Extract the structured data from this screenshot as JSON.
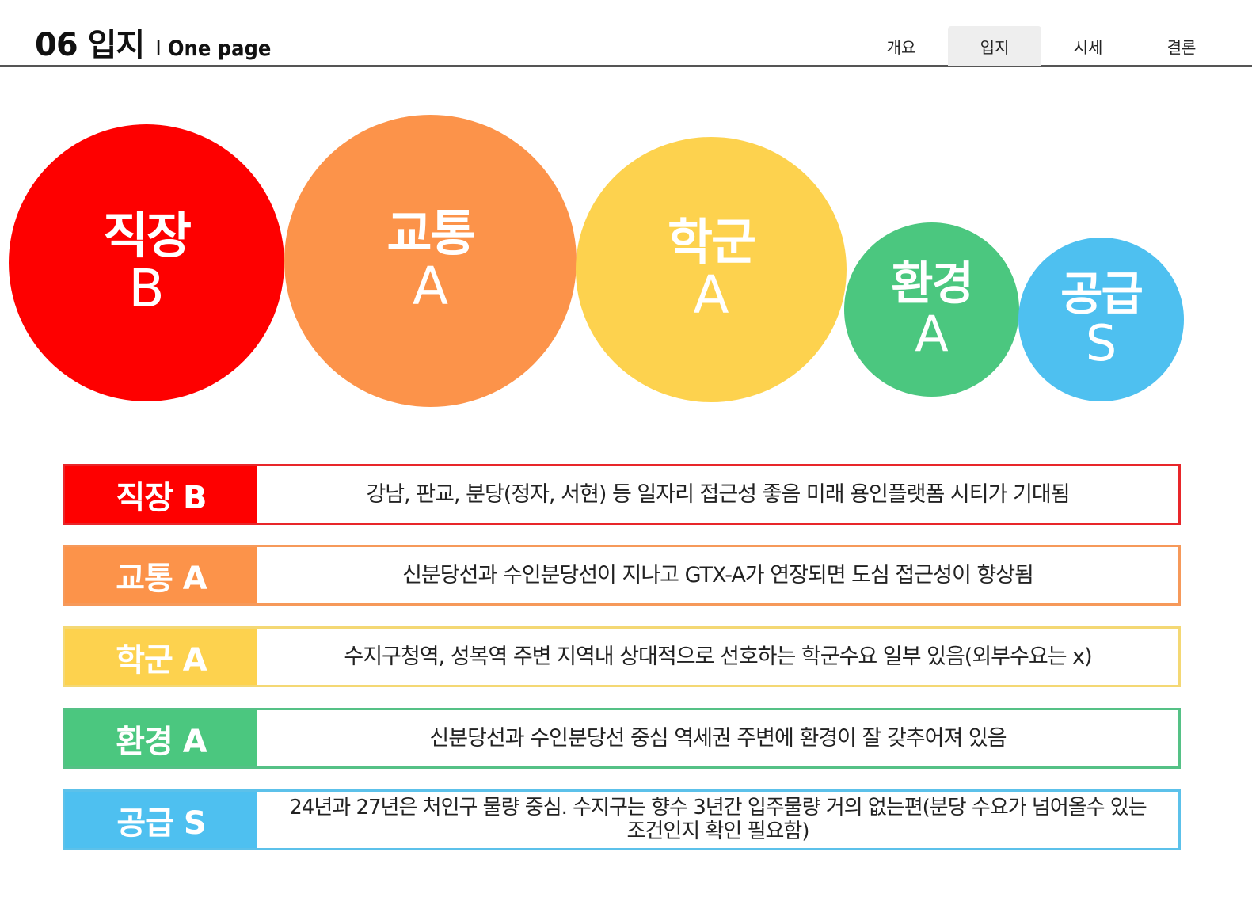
{
  "header": {
    "title": "06 입지",
    "separator": "I",
    "subtitle": "One page",
    "nav": [
      {
        "label": "개요",
        "active": false
      },
      {
        "label": "입지",
        "active": true
      },
      {
        "label": "시세",
        "active": false
      },
      {
        "label": "결론",
        "active": false
      }
    ]
  },
  "colors": {
    "job": "#fe0000",
    "transport": "#fc934a",
    "school": "#fdd24e",
    "environment": "#4bc77f",
    "supply": "#4ec0f0"
  },
  "circles": [
    {
      "label": "직장",
      "grade": "B"
    },
    {
      "label": "교통",
      "grade": "A"
    },
    {
      "label": "학군",
      "grade": "A"
    },
    {
      "label": "환경",
      "grade": "A"
    },
    {
      "label": "공급",
      "grade": "S"
    }
  ],
  "rows": [
    {
      "tag": "직장 B",
      "text": "강남, 판교, 분당(정자, 서현) 등 일자리 접근성 좋음 미래 용인플랫폼 시티가 기대됨"
    },
    {
      "tag": "교통 A",
      "text": "신분당선과 수인분당선이 지나고 GTX-A가 연장되면 도심 접근성이 향상됨"
    },
    {
      "tag": "학군 A",
      "text": "수지구청역, 성복역 주변 지역내 상대적으로 선호하는 학군수요 일부 있음(외부수요는 x)"
    },
    {
      "tag": "환경 A",
      "text": "신분당선과 수인분당선 중심 역세권 주변에 환경이 잘 갖추어져 있음"
    },
    {
      "tag": "공급 S",
      "text": "24년과 27년은 처인구 물량 중심. 수지구는 향수 3년간 입주물량 거의 없는편(분당 수요가 넘어올수 있는 조건인지 확인 필요함)"
    }
  ]
}
